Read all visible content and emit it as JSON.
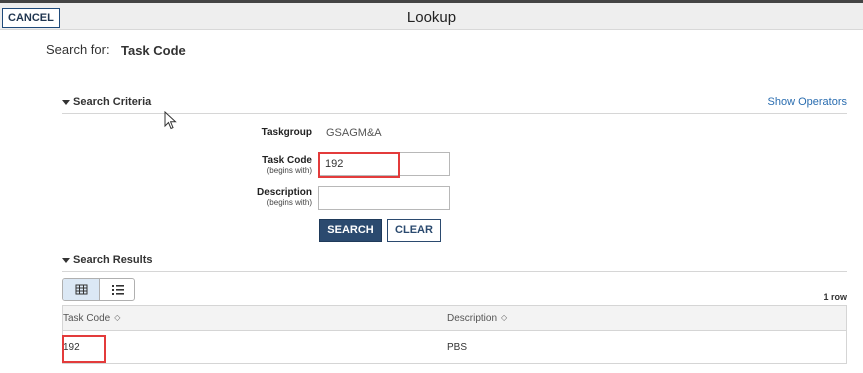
{
  "header": {
    "cancel_label": "CANCEL",
    "title": "Lookup"
  },
  "search_for": {
    "label": "Search for:",
    "value": "Task Code"
  },
  "criteria": {
    "section_label": "Search Criteria",
    "show_operators": "Show Operators",
    "taskgroup": {
      "label": "Taskgroup",
      "value": "GSAGM&A"
    },
    "task_code": {
      "label": "Task Code",
      "sublabel": "(begins with)",
      "value": "192"
    },
    "description": {
      "label": "Description",
      "sublabel": "(begins with)",
      "value": ""
    },
    "search_label": "SEARCH",
    "clear_label": "CLEAR"
  },
  "results": {
    "section_label": "Search Results",
    "row_count": "1 row",
    "columns": [
      "Task Code",
      "Description"
    ],
    "rows": [
      {
        "task_code": "192",
        "description": "PBS"
      }
    ]
  },
  "colors": {
    "accent": "#2b4a6f",
    "highlight": "#e33b3b",
    "link": "#2a6db0"
  },
  "icons": {
    "grid_view": "grid-icon",
    "list_view": "list-icon",
    "sort": "sort-icon",
    "caret": "caret-down-icon"
  }
}
